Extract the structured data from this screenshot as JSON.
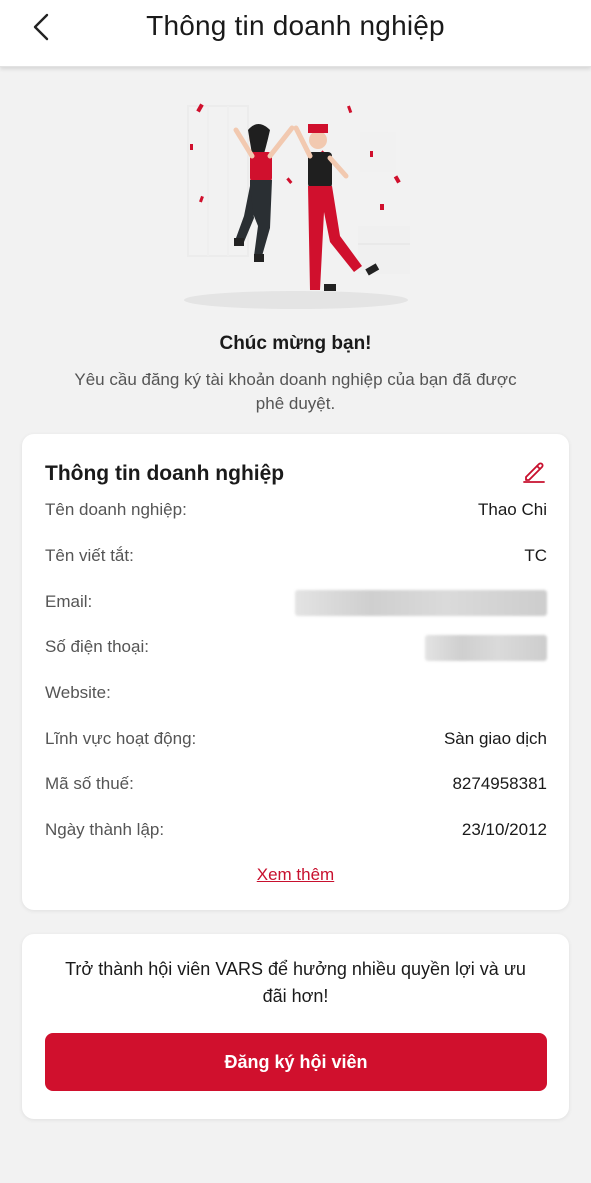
{
  "header": {
    "title": "Thông tin doanh nghiệp",
    "back_icon": "chevron-left-icon"
  },
  "hero": {
    "title": "Chúc mừng bạn!",
    "subtitle": "Yêu cầu đăng ký tài khoản doanh nghiệp của bạn đã được phê duyệt."
  },
  "info": {
    "title": "Thông tin doanh nghiệp",
    "edit_icon": "pencil-icon",
    "rows": [
      {
        "label": "Tên doanh nghiệp:",
        "value": "Thao Chi"
      },
      {
        "label": "Tên viết tắt:",
        "value": "TC"
      },
      {
        "label": "Email:",
        "value": "",
        "redacted": true
      },
      {
        "label": "Số điện thoại:",
        "value": "",
        "redacted": true
      },
      {
        "label": "Website:",
        "value": ""
      },
      {
        "label": "Lĩnh vực hoạt động:",
        "value": "Sàn giao dịch"
      },
      {
        "label": "Mã số thuế:",
        "value": "8274958381"
      },
      {
        "label": "Ngày thành lập:",
        "value": "23/10/2012"
      }
    ],
    "more_link": "Xem thêm"
  },
  "membership": {
    "text": "Trở thành hội viên VARS để hưởng nhiều quyền lợi và ưu đãi hơn!",
    "button": "Đăng ký hội viên"
  },
  "colors": {
    "accent": "#d0102d",
    "background": "#f2f2f2"
  }
}
